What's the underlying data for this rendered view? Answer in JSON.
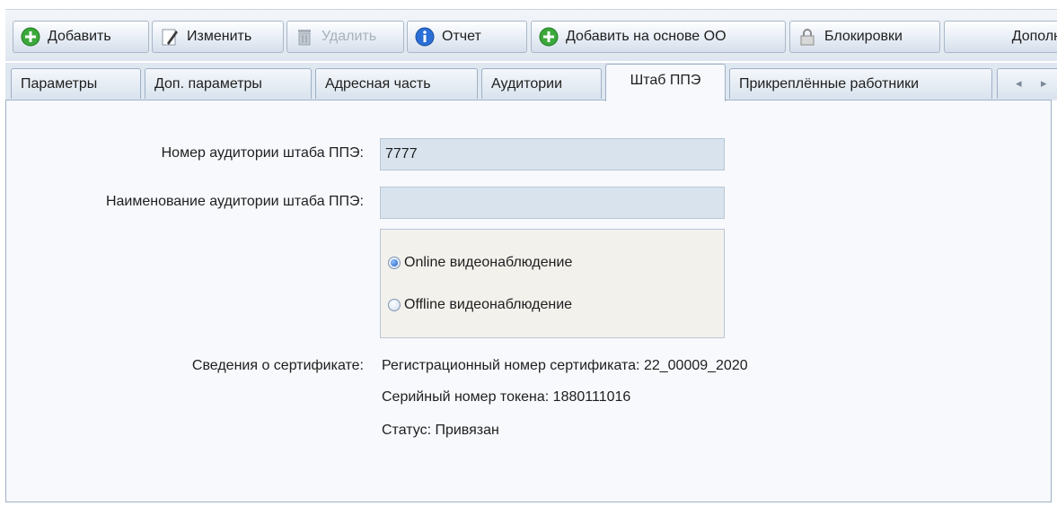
{
  "toolbar": {
    "add": "Добавить",
    "edit": "Изменить",
    "delete": "Удалить",
    "report": "Отчет",
    "add_based_on_oo": "Добавить на основе ОО",
    "locks": "Блокировки",
    "more": "Дополн"
  },
  "tabs": [
    {
      "label": "Параметры"
    },
    {
      "label": "Доп. параметры"
    },
    {
      "label": "Адресная часть"
    },
    {
      "label": "Аудитории"
    },
    {
      "label": "Штаб ППЭ"
    },
    {
      "label": "Прикреплённые работники"
    }
  ],
  "active_tab": "Штаб ППЭ",
  "tab_scroll": {
    "left": "◂",
    "right": "▸"
  },
  "form": {
    "room_number_label": "Номер аудитории штаба ППЭ:",
    "room_number_value": "7777",
    "room_name_label": "Наименование аудитории штаба ППЭ:",
    "room_name_value": "",
    "video_options": [
      {
        "label": "Online видеонаблюдение",
        "checked": true
      },
      {
        "label": "Offline видеонаблюдение",
        "checked": false
      }
    ],
    "cert_label": "Сведения о сертификате:",
    "cert_lines": [
      "Регистрационный номер сертификата: 22_00009_2020",
      "Серийный номер токена: 1880111016",
      "Статус: Привязан"
    ]
  },
  "colors": {
    "accent_green": "#3aa83a",
    "info_blue": "#2a6fd6",
    "field_bg": "#d8e3ee",
    "panel_bg": "#f7f9fc"
  },
  "icons": {
    "add": "plus-circle-green",
    "edit": "pencil-document",
    "delete": "trash-bin",
    "report": "info-circle-blue",
    "add_based": "plus-circle-green",
    "locks": "padlock"
  }
}
